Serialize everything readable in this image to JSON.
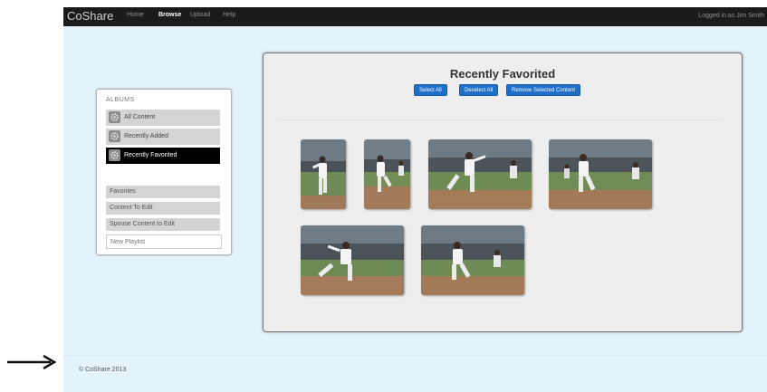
{
  "navbar": {
    "brand": "CoShare",
    "items": [
      "Home",
      "Browse",
      "Upload",
      "Help"
    ],
    "active": "Browse",
    "user_status": "Logged in as Jim Smith"
  },
  "sidebar": {
    "title": "ALBUMS",
    "albums": [
      {
        "label": "All Content",
        "icon": "gear-icon"
      },
      {
        "label": "Recently Added",
        "icon": "gear-icon"
      },
      {
        "label": "Recently Favorited",
        "icon": "gear-icon",
        "selected": true
      }
    ],
    "lists": [
      "Favorites",
      "Content To Edit",
      "Spouse Content to Edit"
    ],
    "new_playlist_placeholder": "New Playlist"
  },
  "main": {
    "title": "Recently Favorited",
    "buttons": [
      "Select All",
      "Deselect All",
      "Remove Selected Content"
    ],
    "accent_color": "#1f6fc9",
    "photo_count": 6
  },
  "footer": {
    "copyright": "© CoShare 2013"
  }
}
